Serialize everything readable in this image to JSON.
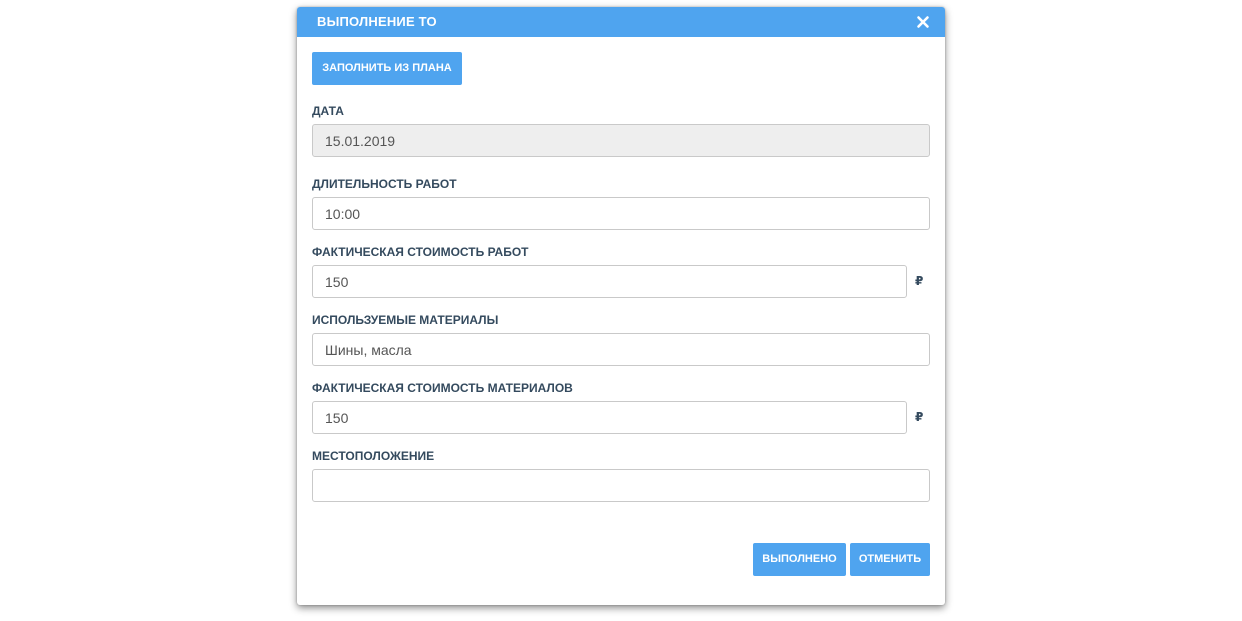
{
  "dialog": {
    "title": "ВЫПОЛНЕНИЕ ТО",
    "accent_color": "#4fa4ef",
    "close_icon": "close-icon"
  },
  "actions": {
    "fill_from_plan_label": "ЗАПОЛНИТЬ ИЗ ПЛАНА",
    "done_label": "ВЫПОЛНЕНО",
    "cancel_label": "ОТМЕНИТЬ"
  },
  "fields": {
    "date": {
      "label": "ДАТА",
      "value": "15.01.2019"
    },
    "duration": {
      "label": "ДЛИТЕЛЬНОСТЬ РАБОТ",
      "value": "10:00"
    },
    "work_cost": {
      "label": "ФАКТИЧЕСКАЯ СТОИМОСТЬ РАБОТ",
      "value": "150",
      "currency": "₽"
    },
    "materials": {
      "label": "ИСПОЛЬЗУЕМЫЕ МАТЕРИАЛЫ",
      "value": "Шины, масла"
    },
    "materials_cost": {
      "label": "ФАКТИЧЕСКАЯ СТОИМОСТЬ МАТЕРИАЛОВ",
      "value": "150",
      "currency": "₽"
    },
    "location": {
      "label": "МЕСТОПОЛОЖЕНИЕ",
      "value": ""
    }
  }
}
